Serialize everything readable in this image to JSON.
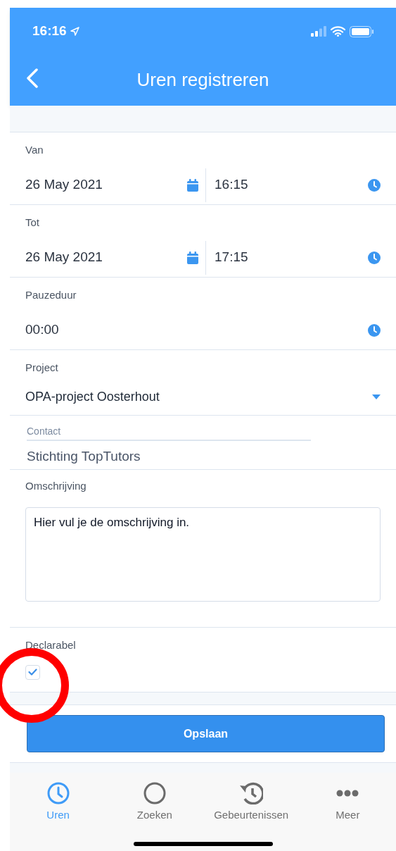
{
  "status_bar": {
    "time": "16:16"
  },
  "header": {
    "title": "Uren registreren"
  },
  "fields": [
    {
      "kind": "datetime",
      "label": "Van",
      "date": "26 May 2021",
      "time": "16:15"
    },
    {
      "kind": "datetime",
      "label": "Tot",
      "date": "26 May 2021",
      "time": "17:15"
    },
    {
      "kind": "time",
      "label": "Pauzeduur",
      "value": "00:00"
    },
    {
      "kind": "select",
      "label": "Project",
      "value": "OPA-project Oosterhout"
    },
    {
      "kind": "readonly",
      "label": "Contact",
      "value": "Stichting TopTutors"
    },
    {
      "kind": "textarea",
      "label": "Omschrijving",
      "value": "Hier vul je de omschrijving in."
    },
    {
      "kind": "checkbox",
      "label": "Declarabel",
      "checked": true
    }
  ],
  "save_button": "Opslaan",
  "tabs": [
    {
      "kind": "clock",
      "label": "Uren",
      "selected": true
    },
    {
      "kind": "circle",
      "label": "Zoeken",
      "selected": false
    },
    {
      "kind": "history",
      "label": "Gebeurtenissen",
      "selected": false
    },
    {
      "kind": "more",
      "label": "Meer",
      "selected": false
    }
  ],
  "annotations": [
    {
      "kind": "circle"
    }
  ]
}
